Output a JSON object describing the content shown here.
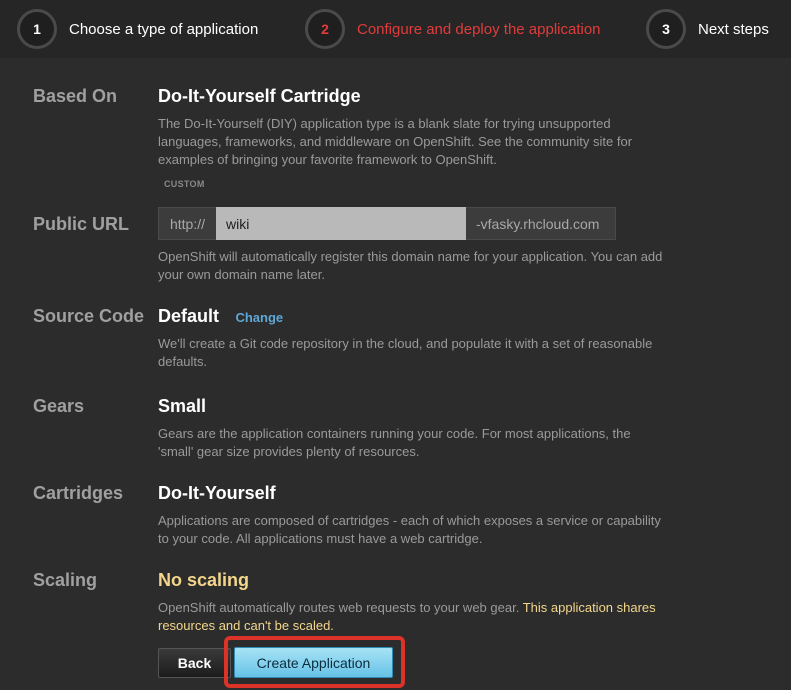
{
  "steps": [
    {
      "number": "1",
      "label": "Choose a type of application",
      "active": false
    },
    {
      "number": "2",
      "label": "Configure and deploy the application",
      "active": true
    },
    {
      "number": "3",
      "label": "Next steps",
      "active": false
    }
  ],
  "based_on": {
    "label": "Based On",
    "value": "Do-It-Yourself Cartridge",
    "description": "The Do-It-Yourself (DIY) application type is a blank slate for trying unsupported languages, frameworks, and middleware on OpenShift. See the community site for examples of bringing your favorite framework to OpenShift.",
    "tag": "CUSTOM"
  },
  "public_url": {
    "label": "Public URL",
    "prefix": "http://",
    "value": "wiki",
    "suffix": "-vfasky.rhcloud.com",
    "description": "OpenShift will automatically register this domain name for your application. You can add your own domain name later."
  },
  "source_code": {
    "label": "Source Code",
    "value": "Default",
    "change_link": "Change",
    "description": "We'll create a Git code repository in the cloud, and populate it with a set of reasonable defaults."
  },
  "gears": {
    "label": "Gears",
    "value": "Small",
    "description": "Gears are the application containers running your code. For most applications, the 'small' gear size provides plenty of resources."
  },
  "cartridges": {
    "label": "Cartridges",
    "value": "Do-It-Yourself",
    "description": "Applications are composed of cartridges - each of which exposes a service or capability to your code. All applications must have a web cartridge."
  },
  "scaling": {
    "label": "Scaling",
    "value": "No scaling",
    "description": "OpenShift automatically routes web requests to your web gear.",
    "warning": "This application shares resources and can't be scaled."
  },
  "buttons": {
    "back": "Back",
    "create": "Create Application"
  },
  "colors": {
    "active_step": "#e13c3c",
    "link": "#5fa7d6",
    "warning": "#f3d68c",
    "highlight_outline": "#dc3328"
  }
}
